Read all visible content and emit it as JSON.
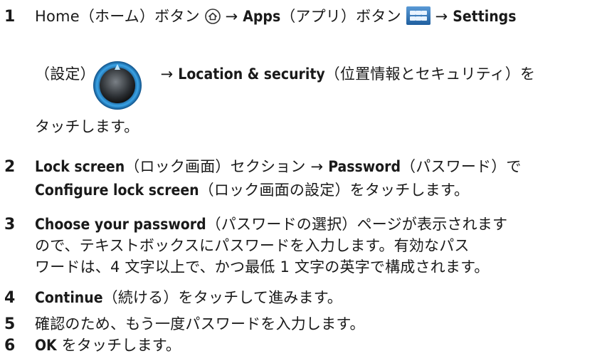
{
  "steps": [
    {
      "num": "1",
      "l1": {
        "a": "Home（ホーム）ボタン",
        "arrow1": "→",
        "apps": "Apps",
        "b": "（アプリ）ボタン",
        "arrow2": "→",
        "settings": "Settings"
      },
      "l2": {
        "a": "（設定）",
        "arrow": "→",
        "loc": "Location & security",
        "b": "（位置情報とセキュリティ）を"
      },
      "l3": "タッチします。"
    },
    {
      "num": "2",
      "l1": {
        "lock": "Lock screen",
        "a": "（ロック画面）セクション",
        "arrow": "→",
        "pw": "Password",
        "b": "（パスワード）で"
      },
      "l2": {
        "cfg": "Configure lock screen",
        "a": "（ロック画面の設定）をタッチします。"
      }
    },
    {
      "num": "3",
      "l1": {
        "choose": "Choose your password",
        "a": "（パスワードの選択）ページが表示されます"
      },
      "l2": "ので、テキストボックスにパスワードを入力します。有効なパス",
      "l3": "ワードは、4 文字以上で、かつ最低 1 文字の英字で構成されます。"
    },
    {
      "num": "4",
      "l1": {
        "cont": "Continue",
        "a": "（続ける）をタッチして進みます。"
      }
    },
    {
      "num": "5",
      "l1": "確認のため、もう一度パスワードを入力します。"
    },
    {
      "num": "6",
      "l1": {
        "ok": "OK",
        "a": " をタッチします。"
      }
    }
  ],
  "icons": {
    "home": "home-icon",
    "apps": "apps-grid-icon",
    "settings": "settings-knob-icon"
  },
  "colors": {
    "text": "#1a1a1a",
    "apps_blue": "#2f6fb1",
    "settings_ring": "#2a8fd4"
  }
}
